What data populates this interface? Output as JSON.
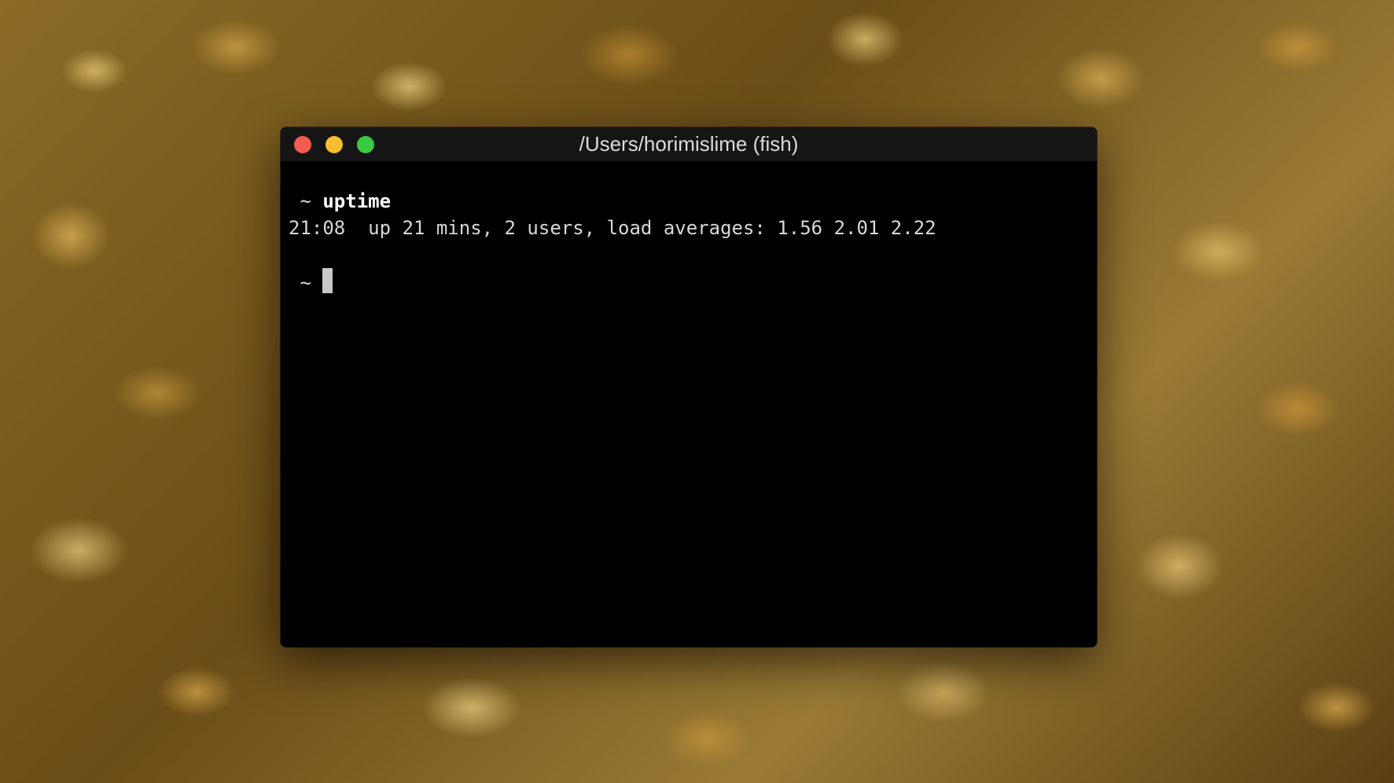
{
  "window": {
    "title": "/Users/horimislime (fish)"
  },
  "terminal": {
    "prompt_symbol": " ~ ",
    "command": "uptime",
    "output": "21:08  up 21 mins, 2 users, load averages: 1.56 2.01 2.22",
    "current_prompt": " ~ "
  },
  "colors": {
    "close": "#f25b52",
    "minimize": "#f7bd30",
    "zoom": "#39c843",
    "terminal_bg": "#000000"
  }
}
